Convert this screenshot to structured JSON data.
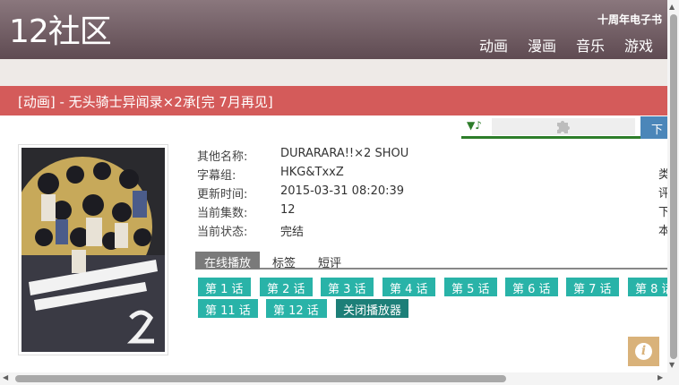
{
  "site": {
    "logo": "12社区",
    "ebook_link": "十周年电子书"
  },
  "nav": [
    "动画",
    "漫画",
    "音乐",
    "游戏"
  ],
  "title_bar": "[动画] - 无头骑士异闻录×2承[完 7月再见]",
  "toolbar": {
    "music_icon": "▼♪",
    "download_label": "下"
  },
  "info": [
    {
      "label": "其他名称:",
      "value": "DURARARA!!×2 SHOU"
    },
    {
      "label": "字幕组:",
      "value": "HKG&TxxZ"
    },
    {
      "label": "更新时间:",
      "value": "2015-03-31 08:20:39"
    },
    {
      "label": "当前集数:",
      "value": "12"
    },
    {
      "label": "当前状态:",
      "value": "完结"
    }
  ],
  "info_right_cut": [
    "类",
    "评",
    "下",
    "本"
  ],
  "tabs": [
    "在线播放",
    "标签",
    "短评"
  ],
  "episodes": [
    "第 1 话",
    "第 2 话",
    "第 3 话",
    "第 4 话",
    "第 5 话",
    "第 6 话",
    "第 7 话",
    "第 8 话",
    "第 11 话",
    "第 12 话",
    "关闭播放器"
  ],
  "info_button_glyph": "i",
  "scroll": {
    "up": "▲",
    "down": "▼",
    "left": "◀",
    "right": "▶"
  },
  "colors": {
    "header": "#6e5b61",
    "title_bar": "#d45b5a",
    "episode": "#29b3a8",
    "episode_close": "#1d7f78",
    "download": "#4b86b9",
    "player_accent": "#2d7d2a"
  },
  "icons": {
    "plugin": "puzzle-icon",
    "info": "info-icon"
  }
}
